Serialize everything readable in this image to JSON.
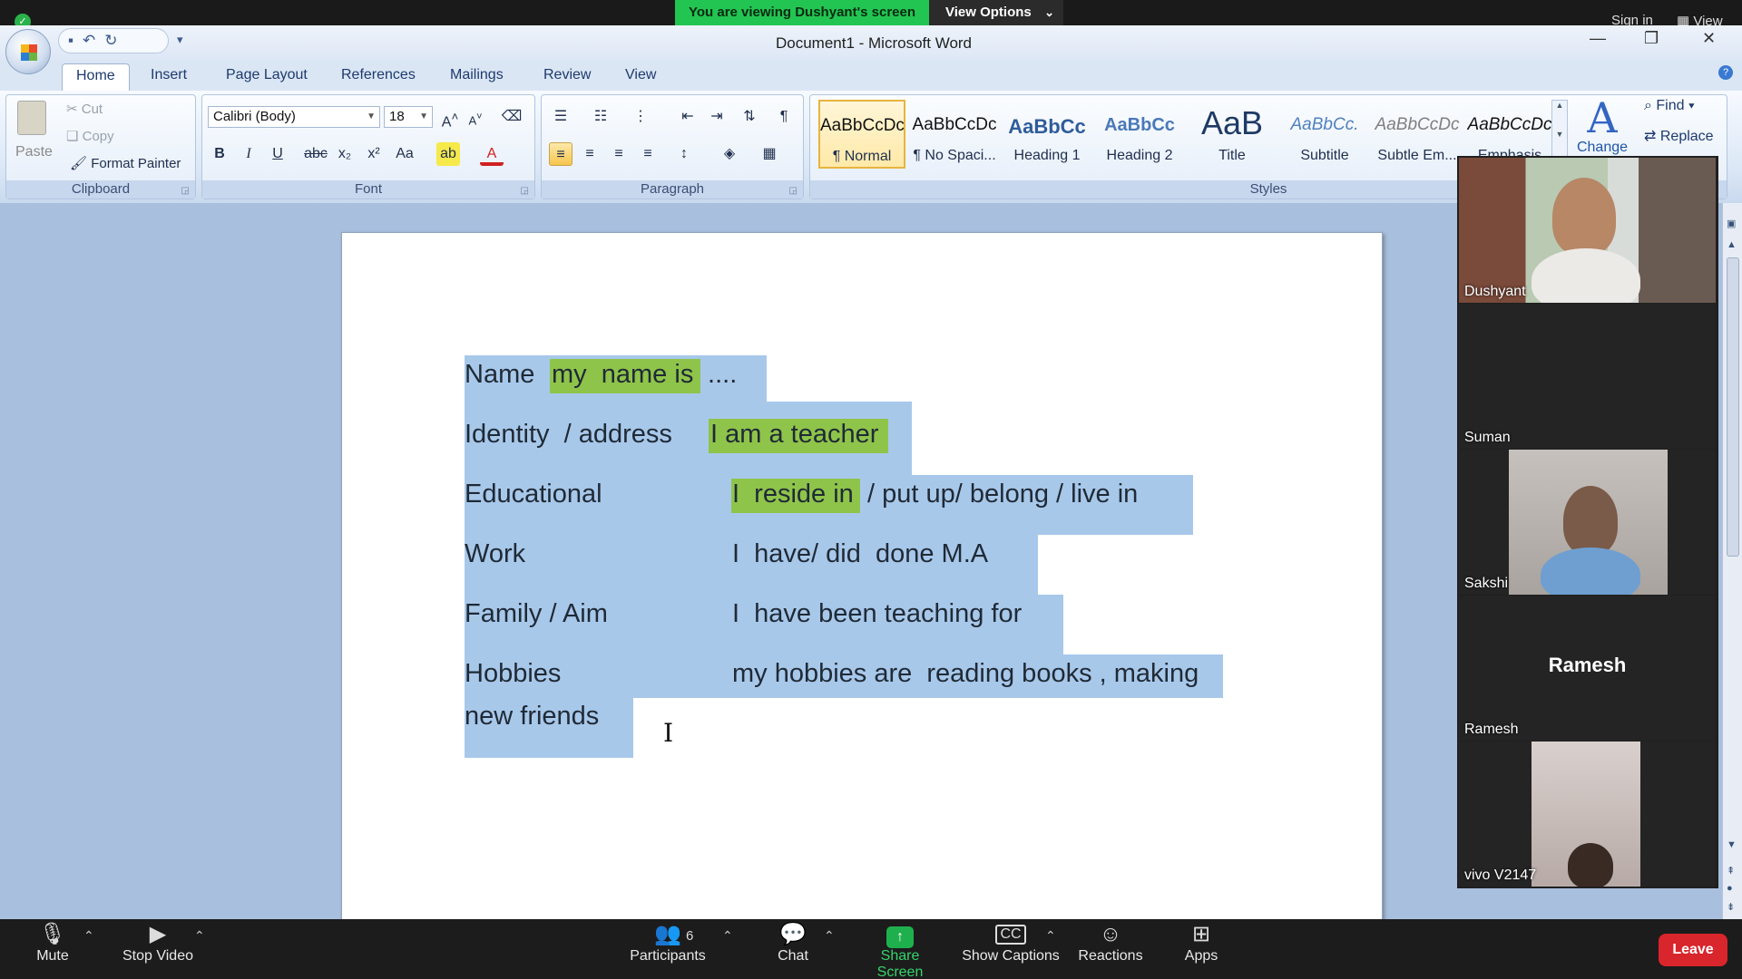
{
  "zoom": {
    "banner": "You are viewing Dushyant's screen",
    "view_options": "View Options",
    "sign_in": "Sign in",
    "view": "View",
    "participants_count": "6",
    "toolbar": {
      "mute": "Mute",
      "stop_video": "Stop Video",
      "participants": "Participants",
      "chat": "Chat",
      "share_screen": "Share Screen",
      "show_captions": "Show Captions",
      "reactions": "Reactions",
      "apps": "Apps",
      "leave": "Leave"
    },
    "gallery": [
      {
        "name": "Dushyant",
        "video": true
      },
      {
        "name": "Suman",
        "video": false
      },
      {
        "name": "Sakshi",
        "video": true
      },
      {
        "name": "Ramesh",
        "video": false,
        "center_label": "Ramesh"
      },
      {
        "name": "vivo V2147",
        "video": true
      }
    ],
    "accent": "#23c552",
    "leave_color": "#d9252c"
  },
  "word": {
    "title": "Document1 - Microsoft Word",
    "tabs": [
      "Home",
      "Insert",
      "Page Layout",
      "References",
      "Mailings",
      "Review",
      "View"
    ],
    "active_tab": "Home",
    "clipboard": {
      "paste": "Paste",
      "cut": "Cut",
      "copy": "Copy",
      "format_painter": "Format Painter",
      "label": "Clipboard"
    },
    "font": {
      "name": "Calibri (Body)",
      "size": "18",
      "label": "Font"
    },
    "paragraph_label": "Paragraph",
    "styles_label": "Styles",
    "styles": [
      {
        "preview": "AaBbCcDc",
        "name": "¶ Normal"
      },
      {
        "preview": "AaBbCcDc",
        "name": "¶ No Spaci..."
      },
      {
        "preview": "AaBbCc",
        "name": "Heading 1"
      },
      {
        "preview": "AaBbCc",
        "name": "Heading 2"
      },
      {
        "preview": "AaB",
        "name": "Title"
      },
      {
        "preview": "AaBbCc.",
        "name": "Subtitle"
      },
      {
        "preview": "AaBbCcDc",
        "name": "Subtle Em..."
      },
      {
        "preview": "AaBbCcDc",
        "name": "Emphasis"
      }
    ],
    "change_styles": "Change",
    "find": "Find",
    "replace": "Replace",
    "document": {
      "line1_a": "Name ",
      "line1_hl": "my  name is",
      "line1_b": " ....",
      "line2_a": "Identity  / address  ",
      "line2_hl": "I am a teacher",
      "line3_a": "Educational",
      "line3_hl": "I  reside in",
      "line3_b": " / put up/ belong / live in",
      "line4_a": "Work",
      "line4_b": "I  have/ did  done M.A",
      "line5_a": "Family / Aim",
      "line5_b": "I  have been teaching for",
      "line6_a": "Hobbies",
      "line6_b": "my hobbies are  reading books , making",
      "line7": "new friends"
    },
    "selection_color": "#a8c8ea",
    "highlight_color": "#8fc44a"
  }
}
